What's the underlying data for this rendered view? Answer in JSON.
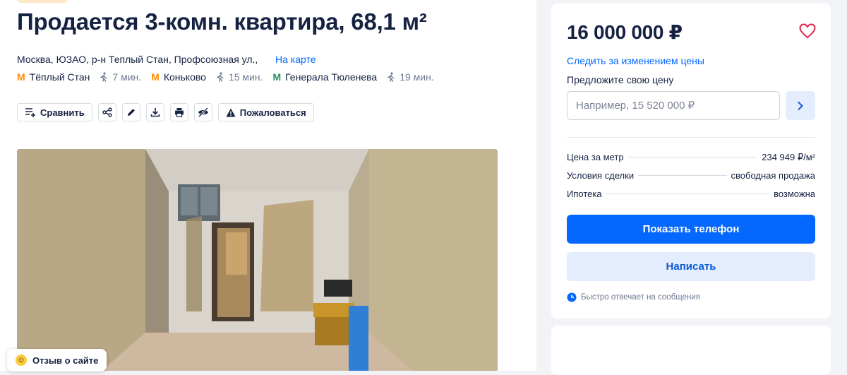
{
  "listing": {
    "title": "Продается 3-комн. квартира, 68,1 м²",
    "address": "Москва, ЮЗАО, р-н Теплый Стан, Профсоюзная ул.,",
    "map_link": "На карте",
    "metro": [
      {
        "station": "Тёплый Стан",
        "time": "7 мин.",
        "color": "#ff8c00"
      },
      {
        "station": "Коньково",
        "time": "15 мин.",
        "color": "#ff8c00"
      },
      {
        "station": "Генерала Тюленева",
        "time": "19 мин.",
        "color": "#1f8f5f"
      }
    ]
  },
  "toolbar": {
    "compare": "Сравнить",
    "report": "Пожаловаться",
    "icons": [
      "compare-icon",
      "share-icon",
      "edit-icon",
      "download-icon",
      "print-icon",
      "hide-icon",
      "warning-icon"
    ]
  },
  "review": {
    "label": "Отзыв о сайте"
  },
  "sidebar": {
    "price": "16 000 000 ₽",
    "follow_price": "Следить за изменением цены",
    "offer_label": "Предложите свою цену",
    "offer_placeholder": "Например, 15 520 000 ₽",
    "info": [
      {
        "label": "Цена за метр",
        "value": "234 949 ₽/м²"
      },
      {
        "label": "Условия сделки",
        "value": "свободная продажа"
      },
      {
        "label": "Ипотека",
        "value": "возможна"
      }
    ],
    "show_phone": "Показать телефон",
    "write": "Написать",
    "quick_reply": "Быстро отвечает на сообщения"
  },
  "colors": {
    "accent": "#0468ff",
    "accent_light": "#e4edfd",
    "heart": "#e0254b",
    "text": "#152242"
  }
}
